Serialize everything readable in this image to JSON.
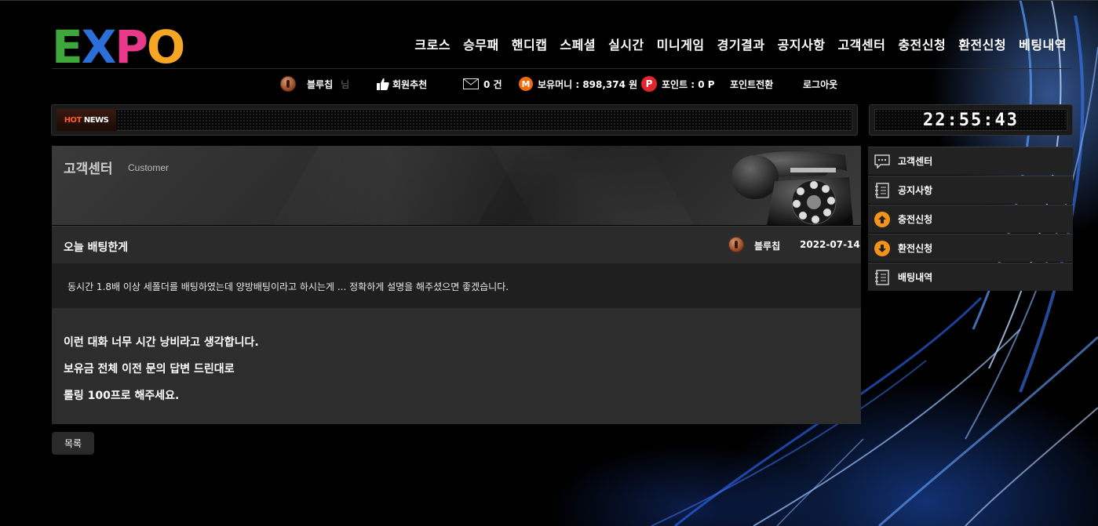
{
  "logo": {
    "letters": [
      "E",
      "X",
      "P",
      "O"
    ],
    "colors": [
      "#3ea63a",
      "#2d6fd8",
      "#e8398a",
      "#f5a623"
    ]
  },
  "nav": {
    "items": [
      "크로스",
      "승무패",
      "핸디캡",
      "스페셜",
      "실시간",
      "미니게임",
      "경기결과",
      "공지사항",
      "고객센터",
      "충전신청",
      "환전신청",
      "베팅내역"
    ]
  },
  "userbar": {
    "username": "블루칩",
    "honorific": "님",
    "recommend_label": "회원추천",
    "messages": "0 건",
    "money_icon": "M",
    "money_label": "보유머니 : 898,374 원",
    "points_icon": "P",
    "points_label": "포인트 : 0 P",
    "points_convert": "포인트전환",
    "logout": "로그아웃"
  },
  "news": {
    "label_hot": "HOT",
    "label_news": "NEWS"
  },
  "clock": {
    "time": "22:55:43"
  },
  "board": {
    "title": "고객센터",
    "subtitle": "Customer"
  },
  "post": {
    "title": "오늘 배팅한게",
    "author": "블루칩",
    "date": "2022-07-14",
    "question": "동시간 1.8배 이상 세폴더를 배팅하였는데 양방배팅이라고 하시는게 ... 정확하게 설명을 해주셨으면 좋겠습니다.",
    "answer_lines": [
      "이런 대화 너무 시간 낭비라고 생각합니다.",
      "보유금 전체 이전 문의 답변 드린대로",
      "롤링 100프로 해주세요."
    ],
    "list_button": "목록"
  },
  "side_menu": {
    "items": [
      {
        "label": "고객센터",
        "icon": "chat-bubble-icon"
      },
      {
        "label": "공지사항",
        "icon": "notebook-icon"
      },
      {
        "label": "충전신청",
        "icon": "arrow-up-circle-icon"
      },
      {
        "label": "환전신청",
        "icon": "arrow-down-circle-icon"
      },
      {
        "label": "배팅내역",
        "icon": "notebook-icon"
      }
    ]
  }
}
